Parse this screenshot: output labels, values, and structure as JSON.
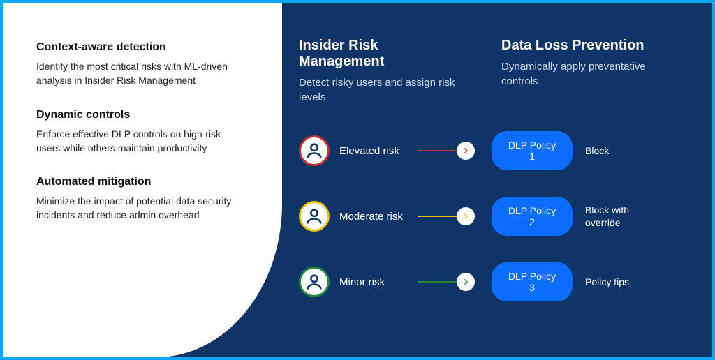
{
  "features": [
    {
      "title": "Context-aware detection",
      "desc": "Identify the most critical risks with ML-driven analysis in Insider Risk Management"
    },
    {
      "title": "Dynamic controls",
      "desc": "Enforce effective DLP controls on high-risk users while others maintain productivity"
    },
    {
      "title": "Automated mitigation",
      "desc": "Minimize the impact of potential data security incidents and reduce admin overhead"
    }
  ],
  "columns": {
    "irm": {
      "title": "Insider Risk Management",
      "sub": "Detect risky users and assign risk levels"
    },
    "dlp": {
      "title": "Data Loss Prevention",
      "sub": "Dynamically apply preventative controls"
    }
  },
  "risks": [
    {
      "label": "Elevated risk",
      "policy": "DLP Policy 1",
      "action": "Block",
      "color": "#c53030"
    },
    {
      "label": "Moderate risk",
      "policy": "DLP Policy 2",
      "action": "Block with override",
      "color": "#e9c000"
    },
    {
      "label": "Minor risk",
      "policy": "DLP Policy 3",
      "action": "Policy tips",
      "color": "#1f8a3b"
    }
  ]
}
